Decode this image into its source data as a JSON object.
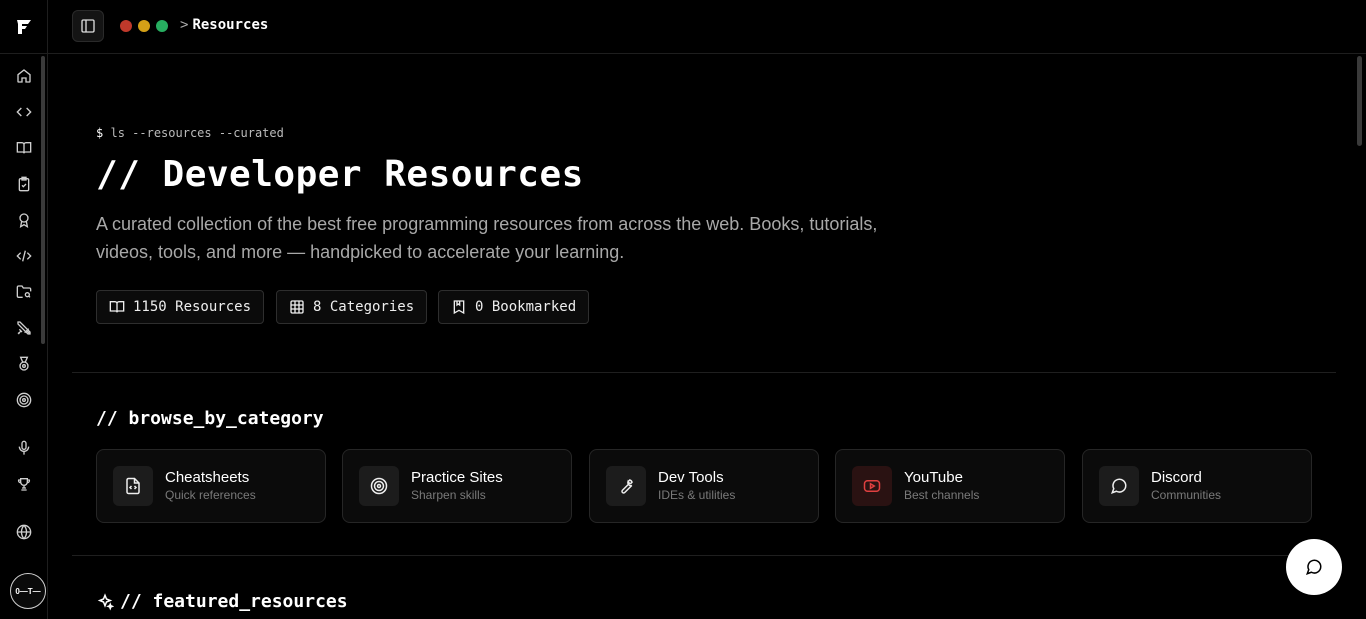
{
  "app": {
    "logo_letter": "F"
  },
  "sidebar": {
    "items": [
      {
        "icon": "home-icon"
      },
      {
        "icon": "code-icon"
      },
      {
        "icon": "book-open-icon"
      },
      {
        "icon": "clipboard-check-icon"
      },
      {
        "icon": "award-icon"
      },
      {
        "icon": "code-slash-icon"
      },
      {
        "icon": "folder-search-icon"
      },
      {
        "icon": "swords-icon"
      },
      {
        "icon": "medal-icon"
      },
      {
        "icon": "target-icon"
      },
      {
        "icon": "mic-icon"
      },
      {
        "icon": "trophy-icon"
      },
      {
        "icon": "globe-icon"
      }
    ],
    "avatar_text": "0—T—"
  },
  "topbar": {
    "dots": [
      "#c0392b",
      "#d4a017",
      "#27ae60"
    ],
    "breadcrumb_sep": ">",
    "breadcrumb": "Resources"
  },
  "hero": {
    "command": "ls --resources --curated",
    "command_prompt": "$",
    "title": "// Developer Resources",
    "description": "A curated collection of the best free programming resources from across the web. Books, tutorials, videos, tools, and more — handpicked to accelerate your learning.",
    "stats": [
      {
        "label": "1150 Resources",
        "icon": "book-open-icon"
      },
      {
        "label": "8 Categories",
        "icon": "grid-icon"
      },
      {
        "label": "0 Bookmarked",
        "icon": "bookmark-icon"
      }
    ]
  },
  "browse": {
    "heading": "// browse_by_category",
    "categories": [
      {
        "name": "Cheatsheets",
        "sub": "Quick references",
        "icon": "file-code-icon"
      },
      {
        "name": "Practice Sites",
        "sub": "Sharpen skills",
        "icon": "target-icon"
      },
      {
        "name": "Dev Tools",
        "sub": "IDEs & utilities",
        "icon": "wrench-icon"
      },
      {
        "name": "YouTube",
        "sub": "Best channels",
        "icon": "youtube-icon"
      },
      {
        "name": "Discord",
        "sub": "Communities",
        "icon": "chat-bubble-icon"
      }
    ]
  },
  "featured": {
    "heading": "// featured_resources"
  },
  "colors": {
    "background": "#000000",
    "accent_youtube": "#e04040"
  }
}
